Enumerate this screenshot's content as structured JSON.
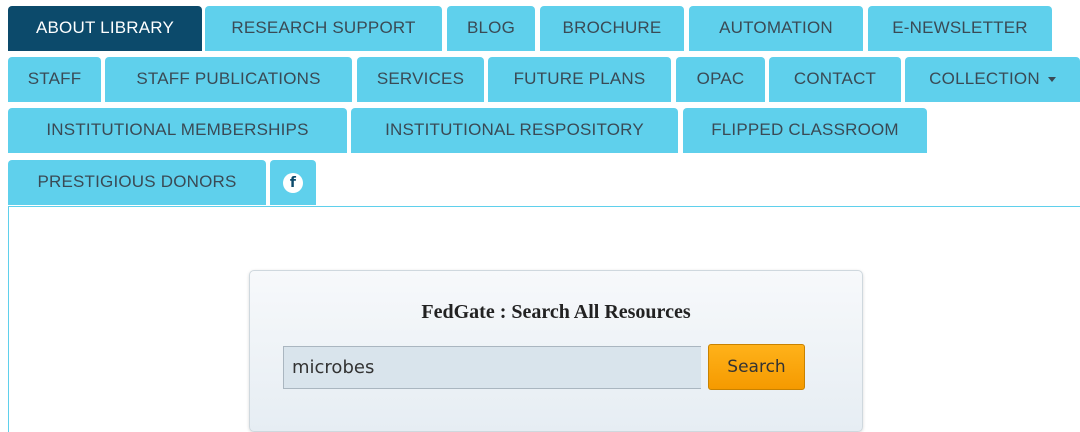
{
  "nav": {
    "tabs": [
      {
        "id": "about-library",
        "label": "ABOUT LIBRARY",
        "active": true
      },
      {
        "id": "research-support",
        "label": "RESEARCH SUPPORT"
      },
      {
        "id": "blog",
        "label": "BLOG"
      },
      {
        "id": "brochure",
        "label": "BROCHURE"
      },
      {
        "id": "automation",
        "label": "AUTOMATION"
      },
      {
        "id": "e-newsletter",
        "label": "E-NEWSLETTER"
      },
      {
        "id": "staff",
        "label": "STAFF"
      },
      {
        "id": "staff-publications",
        "label": "STAFF PUBLICATIONS"
      },
      {
        "id": "services",
        "label": "SERVICES"
      },
      {
        "id": "future-plans",
        "label": "FUTURE PLANS"
      },
      {
        "id": "opac",
        "label": "OPAC"
      },
      {
        "id": "contact",
        "label": "CONTACT"
      },
      {
        "id": "collection",
        "label": "COLLECTION",
        "dropdown": true
      },
      {
        "id": "institutional-memberships",
        "label": "INSTITUTIONAL MEMBERSHIPS"
      },
      {
        "id": "institutional-respository",
        "label": "INSTITUTIONAL RESPOSITORY"
      },
      {
        "id": "flipped-classroom",
        "label": "FLIPPED CLASSROOM"
      },
      {
        "id": "prestigious-donors",
        "label": "PRESTIGIOUS DONORS"
      }
    ],
    "facebook": {
      "glyph": "f",
      "icon": "facebook-icon"
    }
  },
  "colors": {
    "tab_bg": "#5fd0ec",
    "tab_active_bg": "#0c4a6b",
    "tab_text": "#3a4a55",
    "search_button": "#f59a00"
  },
  "search": {
    "title": "FedGate : Search All Resources",
    "query": "microbes",
    "button_label": "Search"
  }
}
